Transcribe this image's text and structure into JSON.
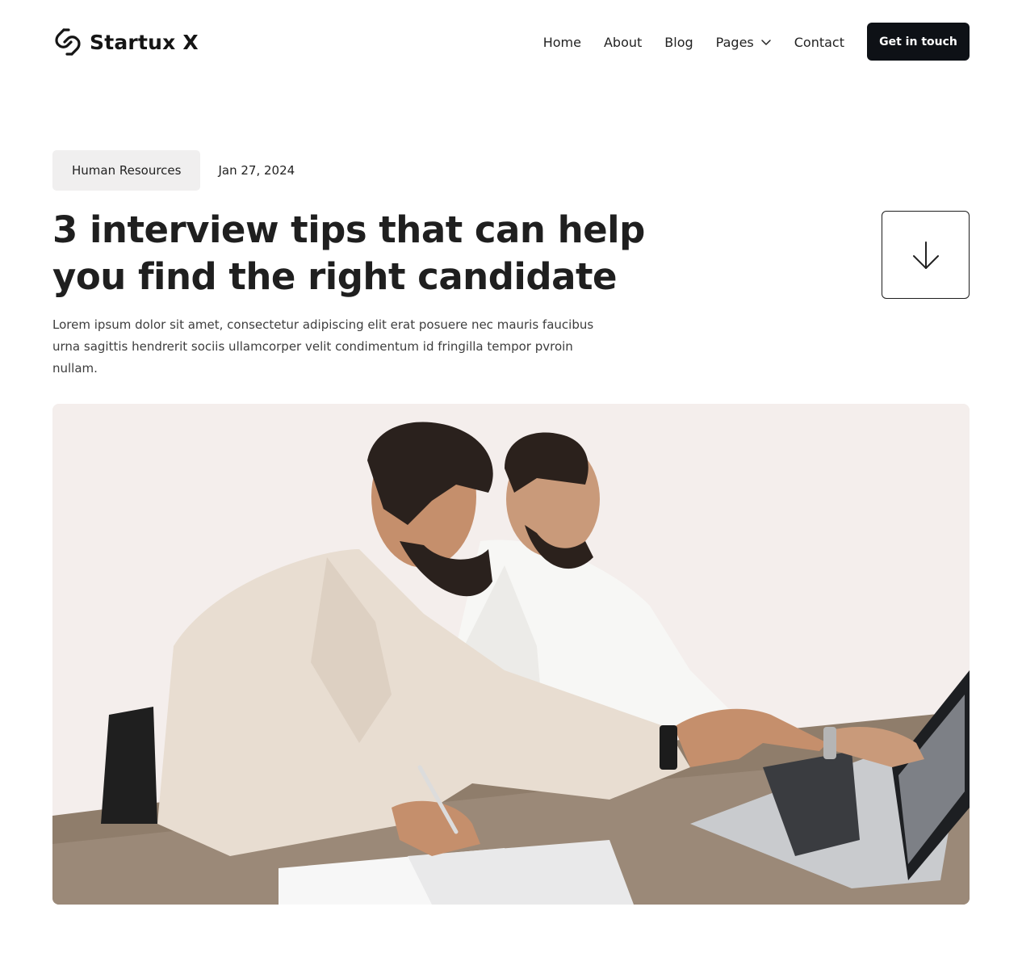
{
  "brand": {
    "name": "Startux X",
    "logo_icon": "link-icon"
  },
  "nav": {
    "items": [
      {
        "label": "Home"
      },
      {
        "label": "About"
      },
      {
        "label": "Blog"
      },
      {
        "label": "Pages",
        "icon": "chevron-down-icon"
      },
      {
        "label": "Contact"
      }
    ],
    "cta_label": "Get in touch"
  },
  "post": {
    "category": "Human Resources",
    "date": "Jan 27, 2024",
    "title": "3 interview tips that can help you find the right candidate",
    "excerpt": "Lorem ipsum dolor sit amet, consectetur adipiscing elit erat posuere nec mauris faucibus urna sagittis hendrerit sociis ullamcorper velit condimentum id fringilla tempor pvroin nullam.",
    "scroll_icon": "arrow-down-icon",
    "hero_image": "two-men-at-laptop-photo"
  },
  "colors": {
    "accent_dark": "#0e1116",
    "tag_bg": "#f0efef",
    "hero_bg": "#f4eeec"
  }
}
